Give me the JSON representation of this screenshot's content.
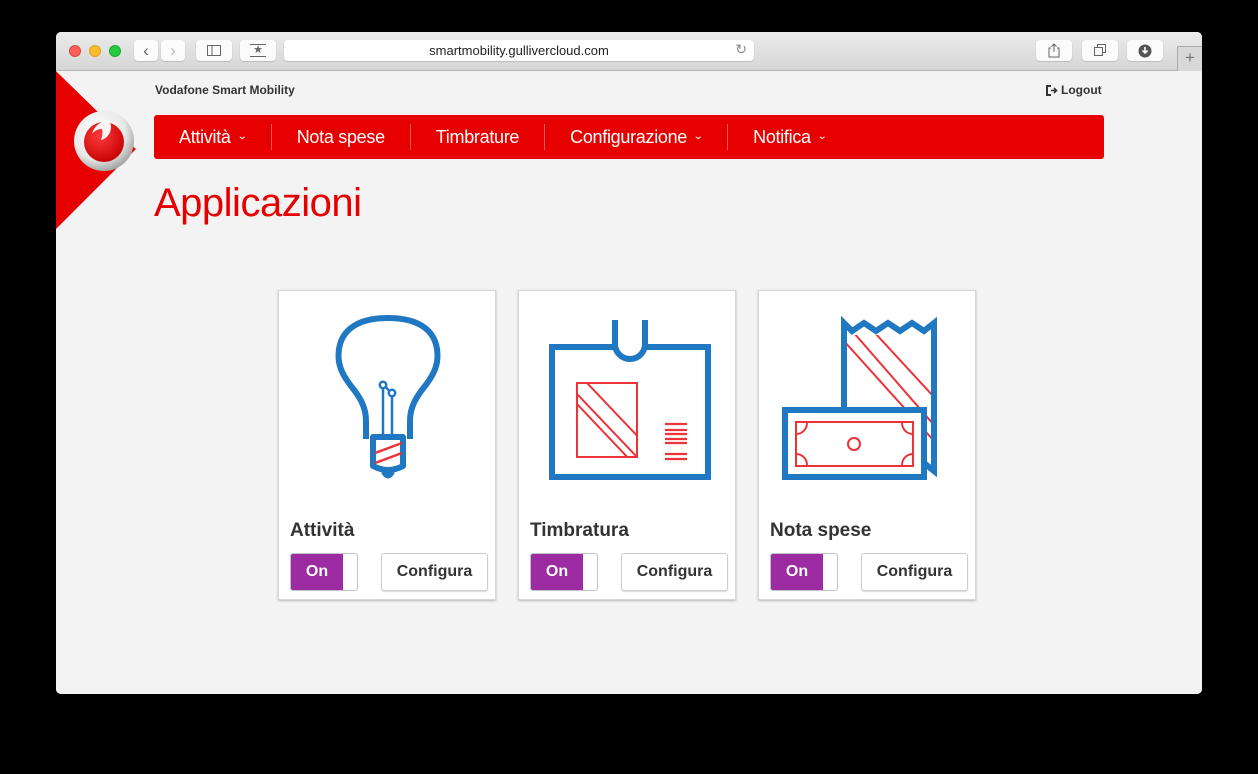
{
  "browser": {
    "url": "smartmobility.gullivercloud.com",
    "buttons": {
      "back": "‹",
      "forward": "›",
      "bookmarks": "★",
      "new_tab": "+"
    }
  },
  "header": {
    "brand": "Vodafone Smart Mobility",
    "logout": "Logout"
  },
  "nav": {
    "items": [
      {
        "label": "Attività",
        "dropdown": true
      },
      {
        "label": "Nota spese",
        "dropdown": false
      },
      {
        "label": "Timbrature",
        "dropdown": false
      },
      {
        "label": "Configurazione",
        "dropdown": true
      },
      {
        "label": "Notifica",
        "dropdown": true
      }
    ],
    "chevron": "⌄"
  },
  "page": {
    "title": "Applicazioni"
  },
  "apps": [
    {
      "name": "Attività",
      "icon": "lightbulb-icon",
      "toggle_label": "On",
      "enabled": true,
      "configure_label": "Configura"
    },
    {
      "name": "Timbratura",
      "icon": "badge-icon",
      "toggle_label": "On",
      "enabled": true,
      "configure_label": "Configura"
    },
    {
      "name": "Nota spese",
      "icon": "receipt-money-icon",
      "toggle_label": "On",
      "enabled": true,
      "configure_label": "Configura"
    }
  ],
  "colors": {
    "brand_red": "#e60000",
    "toggle_purple": "#9c2aa0",
    "icon_blue": "#1f78c1",
    "icon_red": "#ee3338"
  }
}
